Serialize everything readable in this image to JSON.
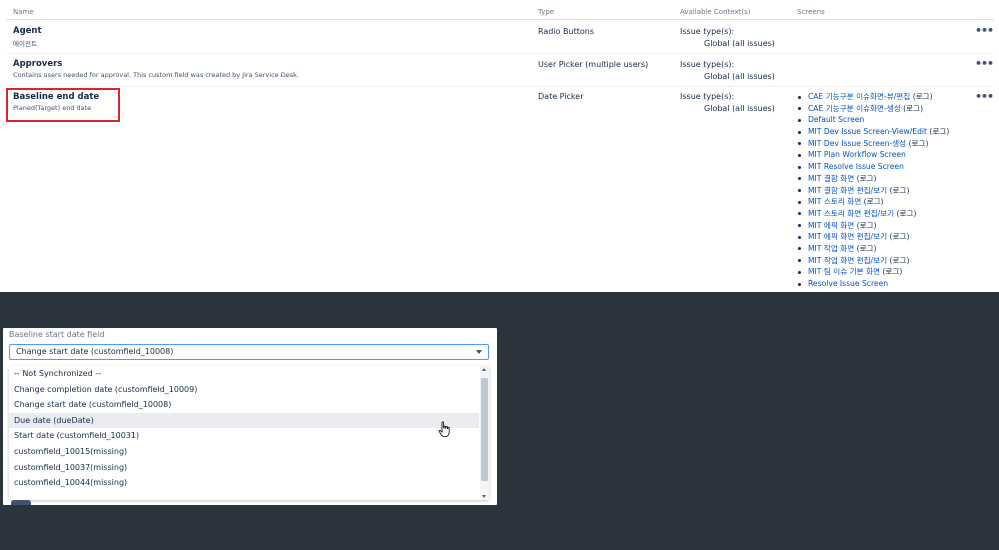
{
  "table": {
    "headers": {
      "name": "Name",
      "type": "Type",
      "context": "Available Context(s)",
      "screens": "Screens"
    },
    "rows": [
      {
        "name": "Agent",
        "description": "에이전트",
        "type": "Radio Buttons",
        "context_line1": "Issue type(s):",
        "context_line2": "Global (all issues)",
        "actions": "•••"
      },
      {
        "name": "Approvers",
        "description": "Contains users needed for approval. This custom field was created by Jira Service Desk.",
        "type": "User Picker (multiple users)",
        "context_line1": "Issue type(s):",
        "context_line2": "Global (all issues)",
        "actions": "•••"
      },
      {
        "name": "Baseline end date",
        "description": "Planed(Target) end date",
        "type": "Date Picker",
        "context_line1": "Issue type(s):",
        "context_line2": "Global (all issues)",
        "actions": "•••",
        "highlight_color": "#d9262c",
        "screens": [
          {
            "link": "CAE 기능구분 이슈화면-뷰/편집",
            "suffix": " (로그)"
          },
          {
            "link": "CAE 기능구분 이슈화면-생성",
            "suffix": " (로그)"
          },
          {
            "link": "Default Screen",
            "suffix": ""
          },
          {
            "link": "MIT Dev Issue Screen-View/Edit",
            "suffix": " (로그)"
          },
          {
            "link": "MIT Dev Issue Screen-생성",
            "suffix": " (로그)"
          },
          {
            "link": "MIT Plan Workflow Screen",
            "suffix": ""
          },
          {
            "link": "MIT Resolve Issue Screen",
            "suffix": ""
          },
          {
            "link": "MIT 결함 화면",
            "suffix": " (로그)"
          },
          {
            "link": "MIT 결함 화면 편집/보기",
            "suffix": " (로그)"
          },
          {
            "link": "MIT 스토리 화면",
            "suffix": " (로그)"
          },
          {
            "link": "MIT 스토리 화면 편집/보기",
            "suffix": " (로그)"
          },
          {
            "link": "MIT 에픽 화면",
            "suffix": " (로그)"
          },
          {
            "link": "MIT 에픽 화면 편집/보기",
            "suffix": " (로그)"
          },
          {
            "link": "MIT 작업 화면",
            "suffix": " (로그)"
          },
          {
            "link": "MIT 작업 화면 편집/보기",
            "suffix": " (로그)"
          },
          {
            "link": "MIT 팀 이슈 기본 화면",
            "suffix": " (로그)"
          },
          {
            "link": "Resolve Issue Screen",
            "suffix": ""
          }
        ]
      }
    ]
  },
  "dialog": {
    "label": "Baseline start date field",
    "selected": "Change start date (customfield_10008)",
    "options": [
      "-- Not Synchronized --",
      "Change completion date (customfield_10009)",
      "Change start date (customfield_10008)",
      "Due date (dueDate)",
      "Start date (customfield_10031)",
      "customfield_10015(missing)",
      "customfield_10037(missing)",
      "customfield_10044(missing)"
    ],
    "hovered_option": "Due date (dueDate)"
  },
  "colors": {
    "link": "#0052cc",
    "text": "#172b4d",
    "overlay": "#2b333c",
    "focus_border": "#4c9aff"
  },
  "icons": {
    "row_actions": "more-horizontal-icon",
    "dropdown": "chevron-down-icon",
    "pointer": "hand-pointer-cursor-icon"
  }
}
